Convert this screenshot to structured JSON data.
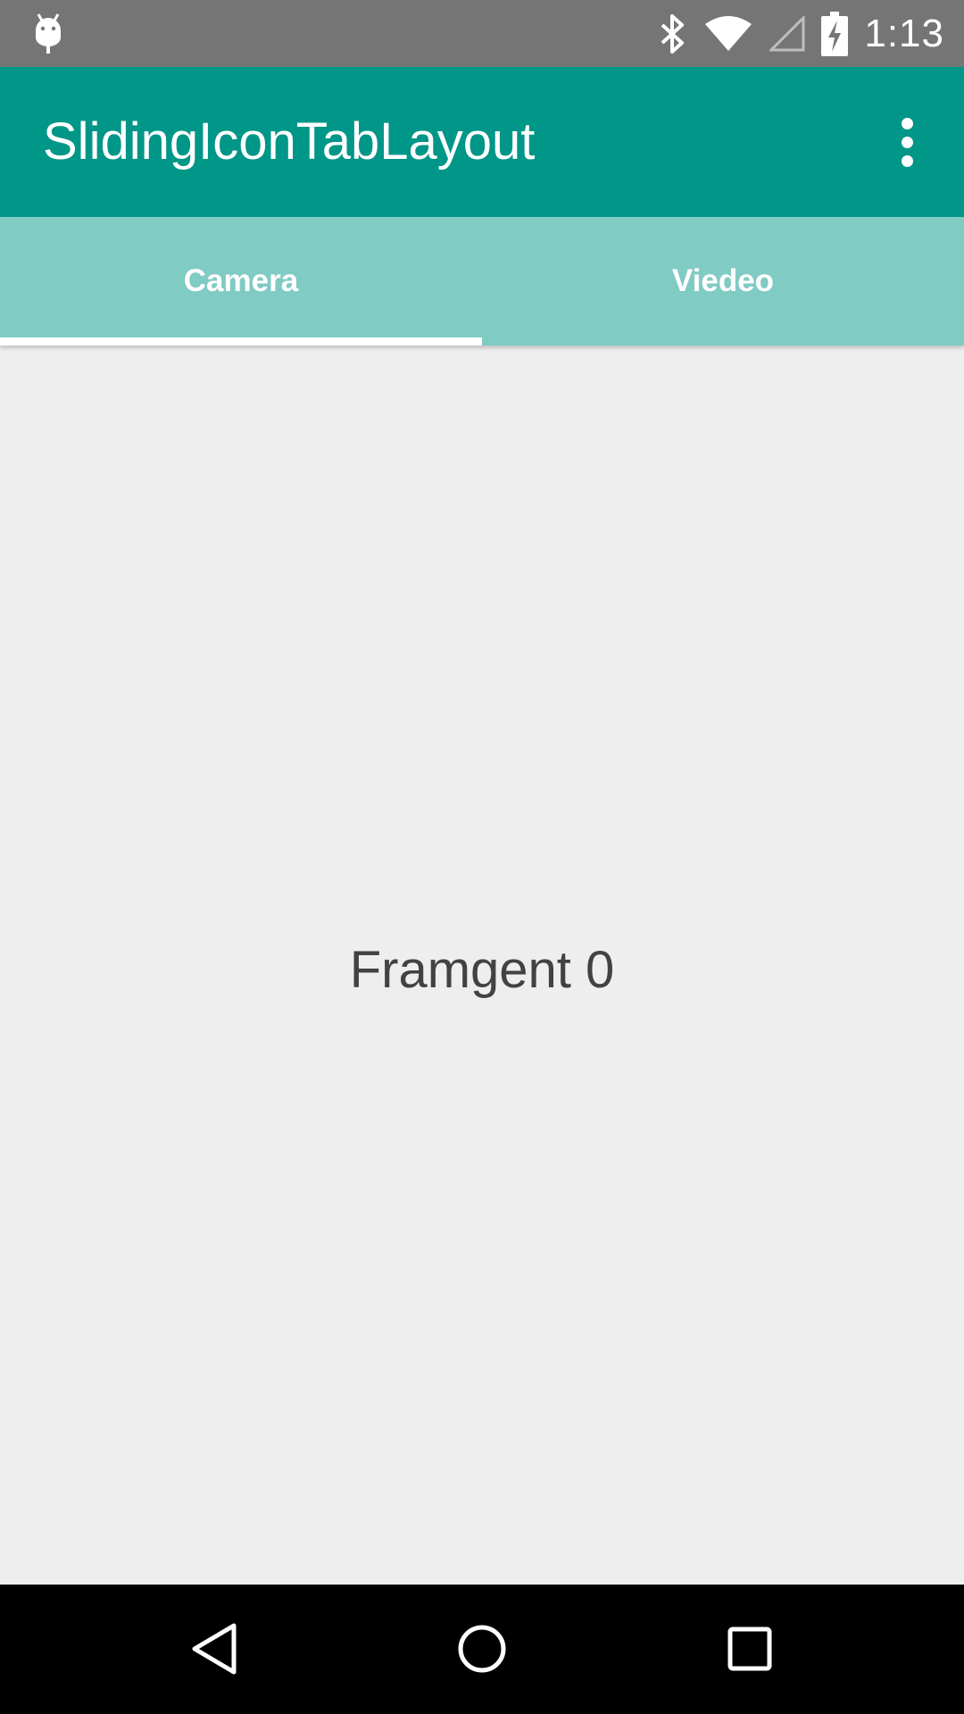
{
  "status_bar": {
    "time": "1:13",
    "icons": [
      "android-debug-icon",
      "bluetooth-icon",
      "wifi-icon",
      "cell-signal-icon",
      "battery-charging-icon"
    ]
  },
  "app_bar": {
    "title": "SlidingIconTabLayout",
    "overflow_icon": "more-vert-icon"
  },
  "tabs": [
    {
      "label": "Camera",
      "selected": true
    },
    {
      "label": "Viedeo",
      "selected": false
    }
  ],
  "content": {
    "text": "Framgent 0"
  },
  "nav_bar": {
    "buttons": [
      "back-icon",
      "home-icon",
      "recents-icon"
    ]
  },
  "colors": {
    "status_bar": "#757575",
    "primary": "#009688",
    "tab_background": "#80CBC4",
    "tab_indicator": "#FFFFFF",
    "content_background": "#EEEEEE",
    "content_text": "#424242",
    "nav_bar": "#000000"
  }
}
